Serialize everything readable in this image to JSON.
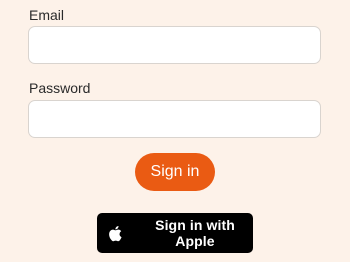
{
  "form": {
    "email": {
      "label": "Email",
      "value": "",
      "placeholder": ""
    },
    "password": {
      "label": "Password",
      "value": "",
      "placeholder": ""
    },
    "sign_in_label": "Sign in",
    "apple_sign_in_label": "Sign in with Apple",
    "apple_icon": "apple-logo-icon"
  },
  "colors": {
    "background": "#fdf2e9",
    "accent": "#ea5b13",
    "apple_button": "#000000",
    "input_border": "#d9d4cf"
  }
}
